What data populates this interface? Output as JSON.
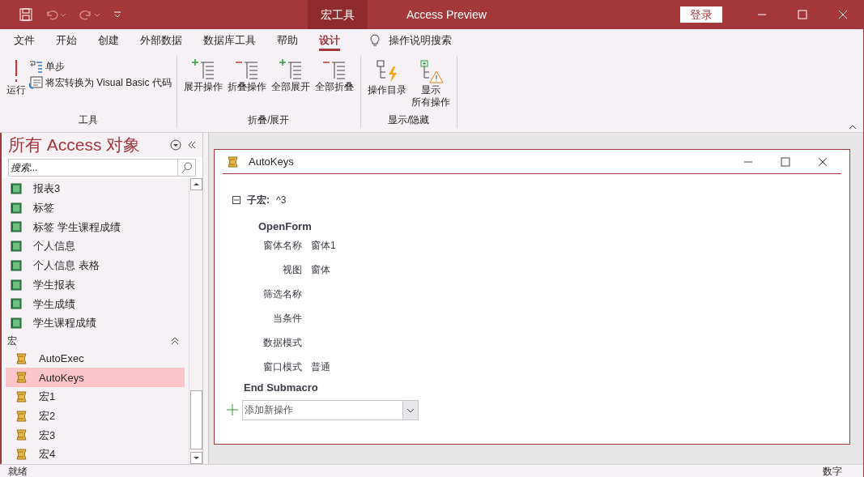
{
  "title_bar": {
    "context_tab": "宏工具",
    "title": "Access Preview",
    "sign_in": "登录"
  },
  "menu_tabs": [
    {
      "label": "文件",
      "selected": false
    },
    {
      "label": "开始",
      "selected": false
    },
    {
      "label": "创建",
      "selected": false
    },
    {
      "label": "外部数据",
      "selected": false
    },
    {
      "label": "数据库工具",
      "selected": false
    },
    {
      "label": "帮助",
      "selected": false
    },
    {
      "label": "设计",
      "selected": true
    }
  ],
  "tell_me": "操作说明搜索",
  "ribbon_groups": [
    {
      "label": "工具",
      "large": [
        {
          "label": "运行"
        }
      ],
      "small": [
        {
          "label": "单步"
        },
        {
          "label": "将宏转换为 Visual Basic 代码"
        }
      ]
    },
    {
      "label": "折叠/展开",
      "large": [
        {
          "label": "展开操作"
        },
        {
          "label": "折叠操作"
        },
        {
          "label": "全部展开"
        },
        {
          "label": "全部折叠"
        }
      ]
    },
    {
      "label": "显示/隐藏",
      "large": [
        {
          "label": "操作目录"
        },
        {
          "lines": [
            "显示",
            "所有操作"
          ]
        }
      ]
    }
  ],
  "nav": {
    "title": "所有 Access 对象",
    "search": {
      "placeholder": "搜索..."
    },
    "reports": [
      {
        "label": "报表3",
        "selected": false
      },
      {
        "label": "标签",
        "selected": false
      },
      {
        "label": "标签 学生课程成绩",
        "selected": false
      },
      {
        "label": "个人信息",
        "selected": false
      },
      {
        "label": "个人信息 表格",
        "selected": false
      },
      {
        "label": "学生报表",
        "selected": false
      },
      {
        "label": "学生成绩",
        "selected": false
      },
      {
        "label": "学生课程成绩",
        "selected": false
      }
    ],
    "macro_group": {
      "label": "宏",
      "expanded": true,
      "items": [
        {
          "label": "AutoExec",
          "selected": false
        },
        {
          "label": "AutoKeys",
          "selected": true
        },
        {
          "label": "宏1",
          "selected": false
        },
        {
          "label": "宏2",
          "selected": false
        },
        {
          "label": "宏3",
          "selected": false
        },
        {
          "label": "宏4",
          "selected": false
        }
      ]
    }
  },
  "document": {
    "title": "AutoKeys",
    "submacro": {
      "label": "子宏:",
      "name": "^3",
      "expanded": true
    },
    "action": "OpenForm",
    "arguments": [
      {
        "name": "窗体名称",
        "value": "窗体1"
      },
      {
        "name": "视图",
        "value": "窗体"
      },
      {
        "name": "筛选名称"
      },
      {
        "name": "当条件"
      },
      {
        "name": "数据模式"
      },
      {
        "name": "窗口模式",
        "value": "普通"
      }
    ],
    "end": "End Submacro",
    "add_action": {
      "placeholder": "添加新操作"
    }
  },
  "status_bar": {
    "left": "就绪",
    "right": "数字"
  }
}
